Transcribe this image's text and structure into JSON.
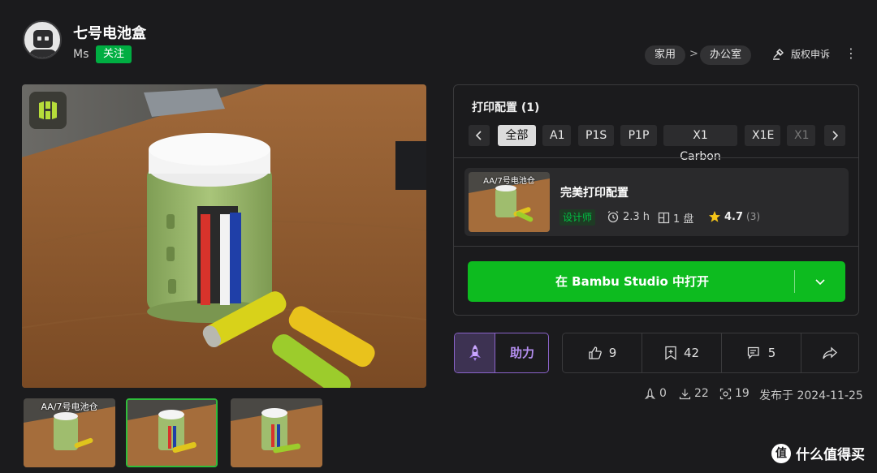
{
  "model": {
    "title": "七号电池盒",
    "author": "Ms",
    "follow_label": "关注"
  },
  "breadcrumb": {
    "items": [
      "家用",
      "办公室"
    ],
    "separator": ">"
  },
  "report_label": "版权申诉",
  "more_icon": "⋮",
  "gallery": {
    "thumbnails": [
      {
        "caption": "AA/7号电池仓"
      },
      {
        "caption": ""
      },
      {
        "caption": ""
      }
    ],
    "active_index": 1
  },
  "print_config": {
    "title": "打印配置 (1)",
    "filters": [
      "全部",
      "A1",
      "P1S",
      "P1P",
      "X1 Carbon",
      "X1E",
      "X1"
    ],
    "selected_filter": "全部",
    "profile": {
      "thumb_caption": "AA/7号电池仓",
      "name": "完美打印配置",
      "tag": "设计师",
      "time": "2.3 h",
      "plates": "1 盘",
      "rating": "4.7",
      "rating_count": "(3)"
    },
    "open_button": "在 Bambu Studio 中打开"
  },
  "boost": {
    "label": "助力"
  },
  "actions": {
    "likes": "9",
    "collects": "42",
    "comments": "5"
  },
  "meta": {
    "boosts": "0",
    "downloads": "22",
    "prints": "19",
    "published": "发布于 2024-11-25"
  },
  "watermark": {
    "badge": "值",
    "text": "什么值得买"
  },
  "colors": {
    "accent_green": "#0dbb1f",
    "follow_green": "#00ae42",
    "boost_purple": "#8a63c9",
    "background": "#1b1b1d"
  }
}
